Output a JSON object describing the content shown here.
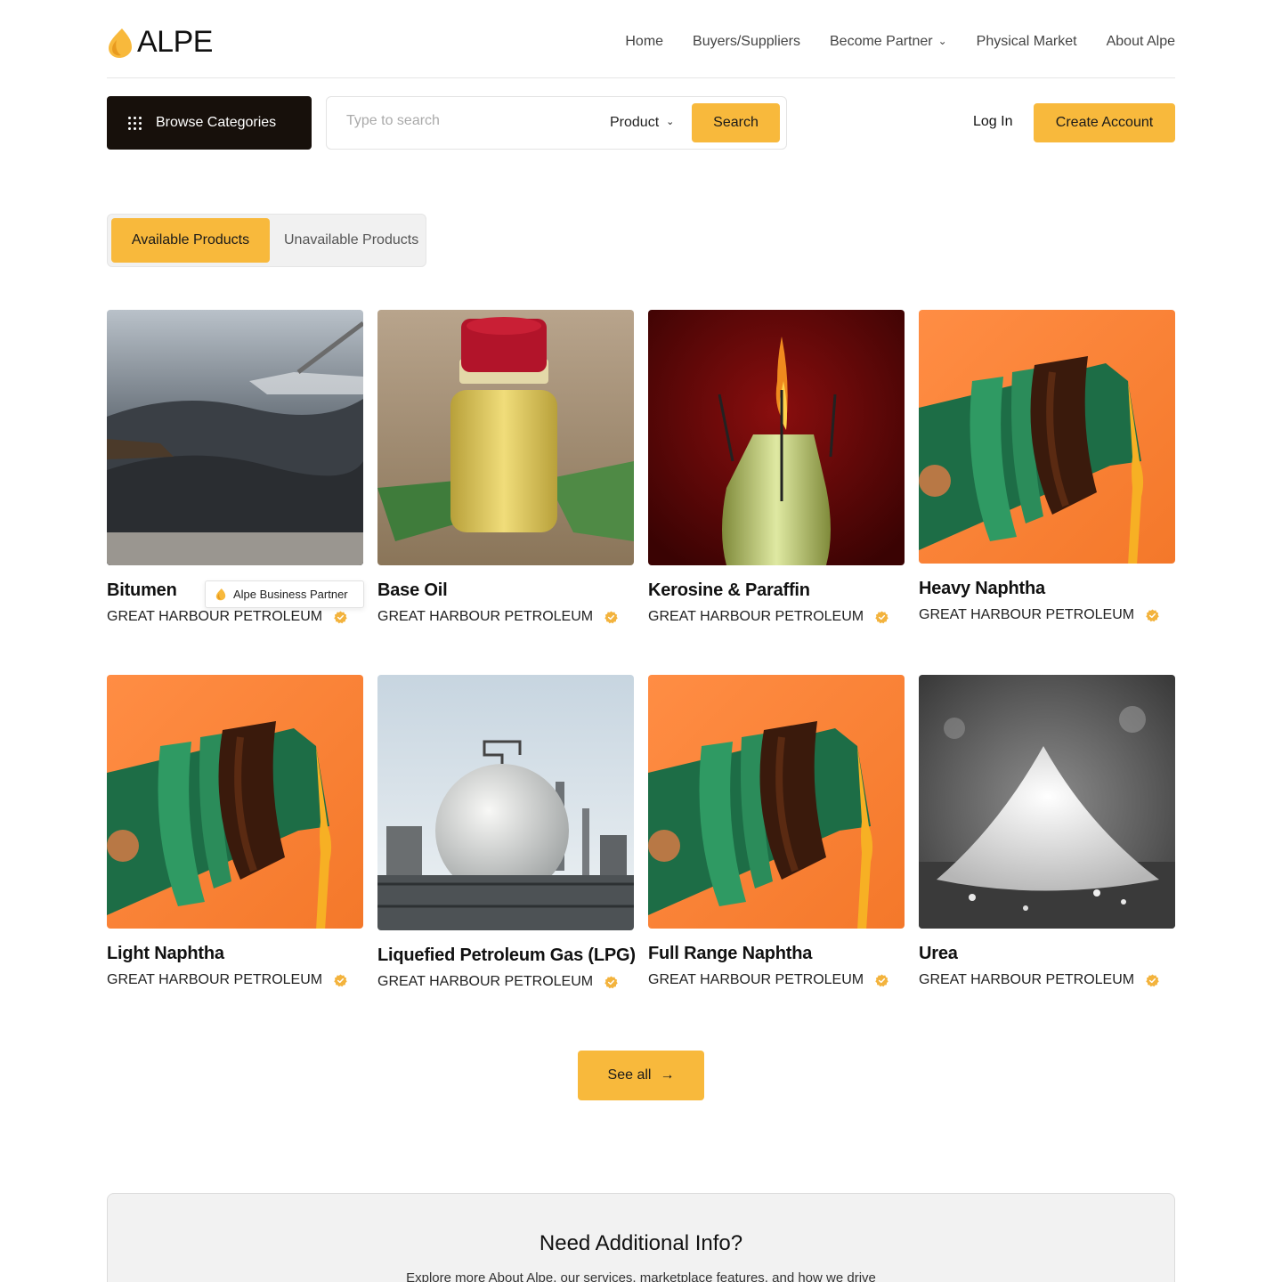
{
  "header": {
    "logo_text": "ALPE",
    "nav": [
      {
        "label": "Home"
      },
      {
        "label": "Buyers/Suppliers"
      },
      {
        "label": "Become Partner"
      },
      {
        "label": "Physical Market"
      },
      {
        "label": "About Alpe"
      }
    ]
  },
  "toolbar": {
    "browse_label": "Browse Categories",
    "search_placeholder": "Type to search",
    "search_value": "",
    "product_select": "Product",
    "search_button": "Search",
    "login": "Log In",
    "create_account": "Create Account"
  },
  "tabs": {
    "active": "Available Products",
    "inactive": "Unavailable Products"
  },
  "tooltip": "Alpe Business Partner",
  "products": [
    {
      "name": "Bitumen",
      "seller": "GREAT HARBOUR PETROLEUM",
      "image": "bitumen"
    },
    {
      "name": "Base Oil",
      "seller": "GREAT HARBOUR PETROLEUM",
      "image": "base-oil"
    },
    {
      "name": "Kerosine & Paraffin",
      "seller": "GREAT HARBOUR PETROLEUM",
      "image": "kerosine"
    },
    {
      "name": "Heavy Naphtha",
      "seller": "GREAT HARBOUR PETROLEUM",
      "image": "naphtha"
    },
    {
      "name": "Light Naphtha",
      "seller": "GREAT HARBOUR PETROLEUM",
      "image": "naphtha"
    },
    {
      "name": "Liquefied Petroleum Gas (LPG)",
      "seller": "GREAT HARBOUR PETROLEUM",
      "image": "lpg"
    },
    {
      "name": "Full Range Naphtha",
      "seller": "GREAT HARBOUR PETROLEUM",
      "image": "naphtha"
    },
    {
      "name": "Urea",
      "seller": "GREAT HARBOUR PETROLEUM",
      "image": "urea"
    }
  ],
  "see_all": "See all",
  "info": {
    "title": "Need Additional Info?",
    "text": "Explore more About Alpe, our services, marketplace features, and how we drive"
  },
  "colors": {
    "accent": "#f8b93c",
    "dark": "#17100b",
    "badge": "#f3b33d"
  }
}
